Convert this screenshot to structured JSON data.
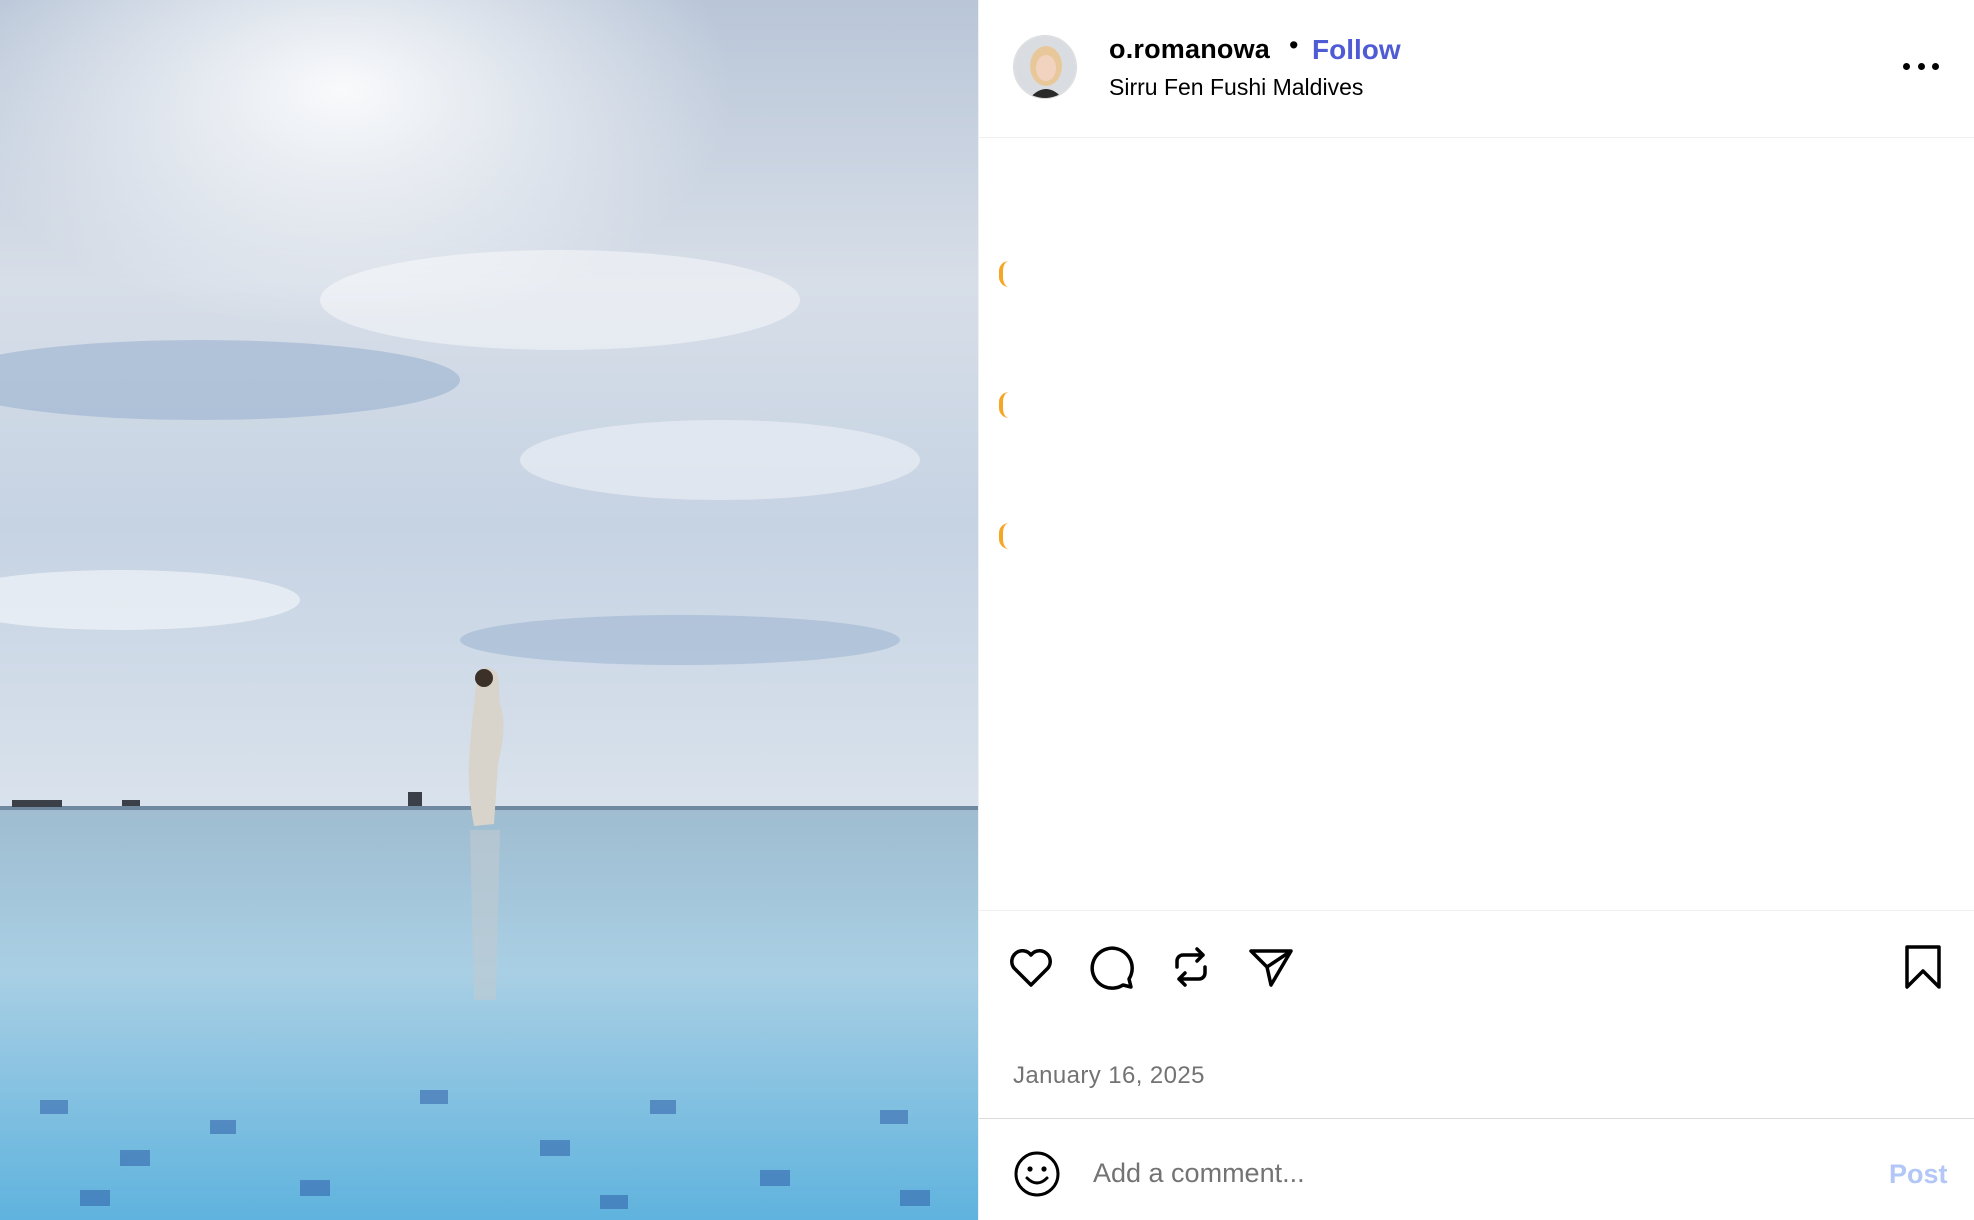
{
  "post": {
    "username": "o.romanowa",
    "separator": "•",
    "follow_label": "Follow",
    "location": "Sirru Fen Fushi Maldives",
    "date": "January 16, 2025"
  },
  "comment": {
    "placeholder": "Add a comment...",
    "post_label": "Post"
  },
  "icons": {
    "more": "more-options-icon",
    "like": "heart-icon",
    "comment": "comment-bubble-icon",
    "repost": "repost-icon",
    "share": "send-icon",
    "save": "bookmark-icon",
    "emoji": "smiley-icon"
  },
  "colors": {
    "follow": "#4f5bd5",
    "post_disabled": "#b2c6f7",
    "secondary_text": "#737373",
    "loading_spinner": "#f5a623"
  }
}
